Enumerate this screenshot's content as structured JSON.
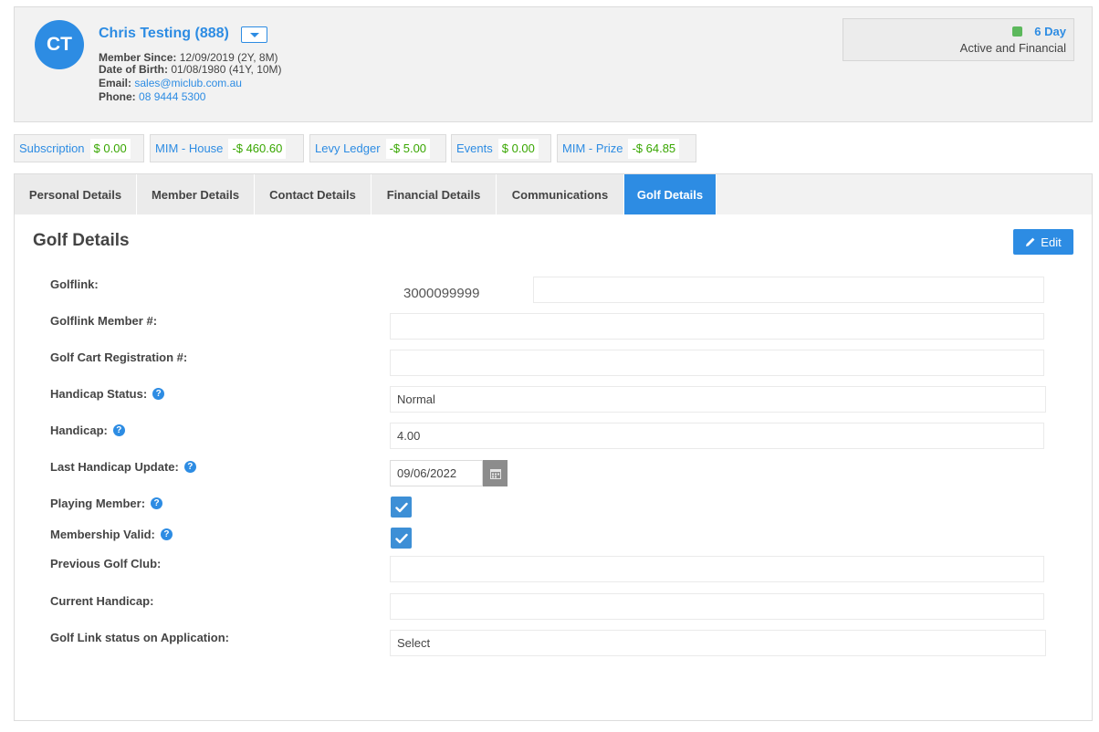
{
  "member": {
    "initials": "CT",
    "name": "Chris Testing (888)",
    "member_since_label": "Member Since:",
    "member_since": "12/09/2019 (2Y, 8M)",
    "dob_label": "Date of Birth:",
    "dob": "01/08/1980 (41Y, 10M)",
    "email_label": "Email:",
    "email": "sales@miclub.com.au",
    "phone_label": "Phone:",
    "phone": "08 9444 5300",
    "status_day": "6 Day",
    "status_text": "Active and Financial",
    "status_color": "#5cb85c"
  },
  "balances": [
    {
      "label": "Subscription",
      "value": "$ 0.00"
    },
    {
      "label": "MIM - House",
      "value": "-$ 460.60"
    },
    {
      "label": "Levy Ledger",
      "value": "-$ 5.00"
    },
    {
      "label": "Events",
      "value": "$ 0.00"
    },
    {
      "label": "MIM - Prize",
      "value": "-$ 64.85"
    }
  ],
  "tabs": [
    {
      "label": "Personal Details"
    },
    {
      "label": "Member Details"
    },
    {
      "label": "Contact Details"
    },
    {
      "label": "Financial Details"
    },
    {
      "label": "Communications"
    },
    {
      "label": "Golf Details",
      "active": true
    }
  ],
  "panel": {
    "title": "Golf Details",
    "edit_label": "Edit",
    "fields": {
      "golflink_label": "Golflink:",
      "golflink_value": "3000099999",
      "golflink_member_label": "Golflink Member #:",
      "golflink_member_value": "",
      "cart_label": "Golf Cart Registration #:",
      "cart_value": "",
      "handicap_status_label": "Handicap Status:",
      "handicap_status_value": "Normal",
      "handicap_label": "Handicap:",
      "handicap_value": "4.00",
      "last_update_label": "Last Handicap Update:",
      "last_update_value": "09/06/2022",
      "playing_member_label": "Playing Member:",
      "playing_member_checked": true,
      "membership_valid_label": "Membership Valid:",
      "membership_valid_checked": true,
      "prev_club_label": "Previous Golf Club:",
      "prev_club_value": "",
      "current_handicap_label": "Current Handicap:",
      "current_handicap_value": "",
      "golflink_status_label": "Golf Link status on Application:",
      "golflink_status_value": "Select"
    }
  },
  "colors": {
    "accent": "#2d8ce3",
    "positive": "#38a600"
  }
}
